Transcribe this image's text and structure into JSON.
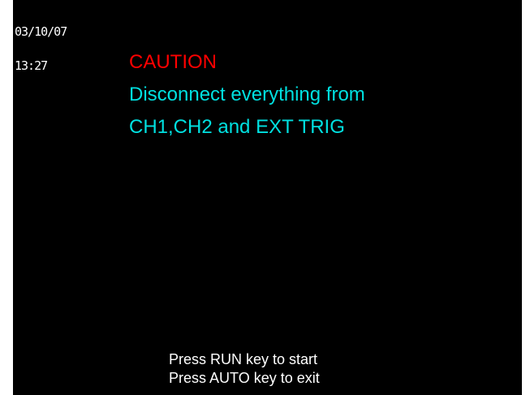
{
  "status": {
    "date": "03/10/07",
    "time": "13:27"
  },
  "message": {
    "heading": "CAUTION",
    "line1": "Disconnect everything from",
    "line2": "CH1,CH2 and EXT TRIG"
  },
  "instructions": {
    "start": "Press RUN key to start",
    "exit": "Press AUTO key to exit"
  },
  "colors": {
    "background": "#000000",
    "heading": "#ff0000",
    "message": "#00e0e0",
    "text": "#ffffff"
  }
}
